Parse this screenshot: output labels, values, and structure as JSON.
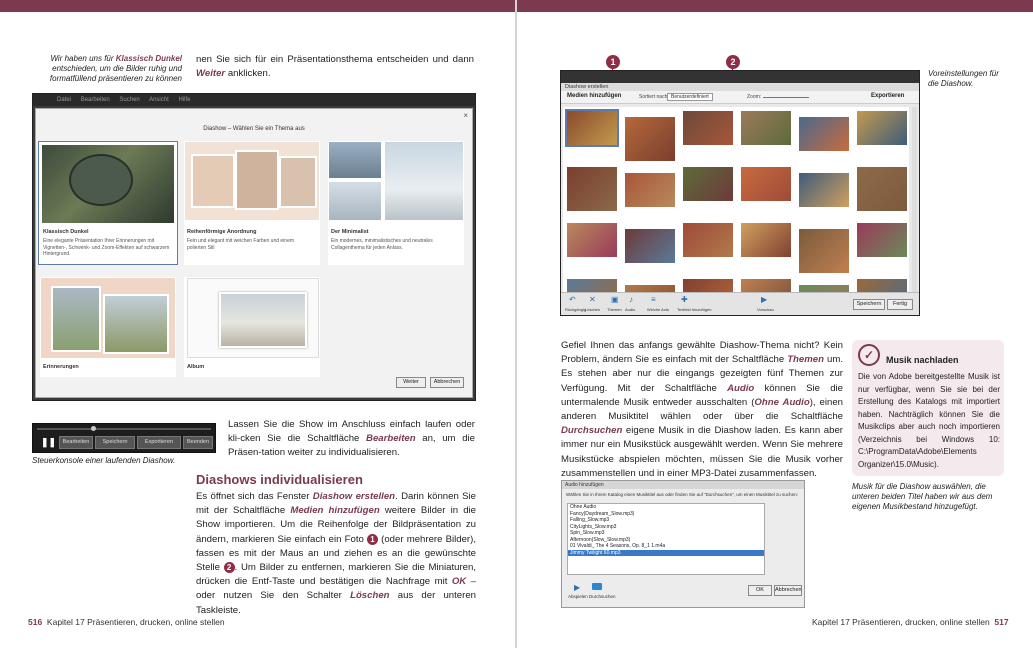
{
  "colors": {
    "accent": "#7b3a4f",
    "marker": "#8d2e46"
  },
  "left_page": {
    "caption_top": "Wir haben uns für Klassisch Dunkel entschieden, um die Bilder ruhig und formatfüllend präsentieren zu können",
    "caption_top_highlight": "Klassisch Dunkel",
    "caption_top_pre": "Wir haben uns für ",
    "caption_top_post": " entschieden, um die Bilder ruhig und formatfüllend präsentieren zu können",
    "intro_pre": "nen Sie sich für ein Präsentationsthema entscheiden und dann ",
    "intro_highlight": "Weiter",
    "intro_post": " anklicken.",
    "app_menu": [
      "Datei",
      "Bearbeiten",
      "Suchen",
      "Ansicht",
      "Hilfe"
    ],
    "dialog_title": "Diashow – Wählen Sie ein Thema aus",
    "themes": [
      {
        "title": "Klassisch Dunkel",
        "text": "Eine elegante Präsentation Ihrer Erinnerungen mit Vignetten-, Schwenk- und Zoom-Effekten auf schwarzem Hintergrund."
      },
      {
        "title": "Reihenförmige Anordnung",
        "text": "Fein und elegant mit weichen Farben und einem polierten Stil"
      },
      {
        "title": "Der Minimalist",
        "text": "Ein modernes, minimalistisches und neutrales Collagenthema für jeden Anlass."
      },
      {
        "title": "Erinnerungen",
        "text": ""
      },
      {
        "title": "Album",
        "text": ""
      }
    ],
    "dialog_buttons": {
      "next": "Weiter",
      "cancel": "Abbrechen"
    },
    "console_buttons": [
      "Bearbeiten",
      "Speichern",
      "Exportieren",
      "Beenden"
    ],
    "console_caption": "Steuerkonsole einer laufenden Diashow.",
    "show_pre": "Lassen Sie die Show im Anschluss einfach laufen oder kli-cken Sie die Schaltfläche ",
    "show_highlight": "Bearbeiten",
    "show_post": " an, um die Präsen-tation weiter zu individualisieren.",
    "heading": "Diashows individualisieren",
    "paragraph_parts": [
      {
        "t": "Es öffnet sich das Fenster ",
        "h": false
      },
      {
        "t": "Diashow erstellen",
        "h": true
      },
      {
        "t": ". Darin können Sie mit der Schaltfläche ",
        "h": false
      },
      {
        "t": "Medien hinzufügen",
        "h": true
      },
      {
        "t": " weitere Bilder in die Show importieren. Um die Reihenfolge der Bildpräsentation zu ändern, markieren Sie einfach ein Foto ",
        "h": false
      },
      {
        "t": "1",
        "n": true
      },
      {
        "t": " (oder mehrere Bilder), fassen es mit der Maus an und ziehen es an die gewünschte Stelle ",
        "h": false
      },
      {
        "t": "2",
        "n": true
      },
      {
        "t": ". Um Bilder zu entfernen, markieren Sie die Miniaturen, drücken die Entf-Taste und bestätigen die Nachfrage mit ",
        "h": false
      },
      {
        "t": "OK",
        "h": true
      },
      {
        "t": " – oder nutzen Sie den Schalter ",
        "h": false
      },
      {
        "t": "Löschen",
        "h": true
      },
      {
        "t": " aus der unteren Taskleiste.",
        "h": false
      }
    ],
    "footer_page": "516",
    "footer_chapter": "Kapitel 17   Präsentieren, drucken, online stellen"
  },
  "right_page": {
    "caption_settings": "Voreinstellungen für die Diashow.",
    "marker_1": "1",
    "marker_2": "2",
    "editor_title": "Diashow erstellen",
    "editor_add_media": "Medien hinzufügen",
    "editor_sort": "Sortiert nach:",
    "editor_sort_value": "Benutzerdefiniert",
    "editor_zoom": "Zoom:",
    "editor_export": "Exportieren",
    "editor_tools": [
      "Rückgängig",
      "Löschen",
      "Themen",
      "Audio",
      "Welche Acts",
      "Textfeld hinzufügen",
      "Vorschau"
    ],
    "editor_save": "Speichern",
    "editor_done": "Fertig",
    "text_parts": [
      {
        "t": "Gefiel Ihnen das anfangs gewählte Diashow-Thema nicht? Kein Problem, ändern Sie es einfach mit der Schaltfläche ",
        "h": false
      },
      {
        "t": "Themen",
        "h": true
      },
      {
        "t": " um. Es stehen aber nur die eingangs gezeigten fünf Themen zur Verfügung. Mit der Schaltfläche ",
        "h": false
      },
      {
        "t": "Audio",
        "h": true
      },
      {
        "t": " können Sie die untermalende Musik entweder ausschalten (",
        "h": false
      },
      {
        "t": "Ohne Audio",
        "h": true
      },
      {
        "t": "), einen anderen Musiktitel wählen oder über die Schaltfläche ",
        "h": false
      },
      {
        "t": "Durchsuchen",
        "h": true
      },
      {
        "t": " eigene Musik in die Diashow laden. Es kann aber immer nur ein Musikstück ausgewählt werden. Wenn Sie mehrere Musikstücke abspielen möchten, müssen Sie die Musik vorher zusammenstellen und in einer MP3-Datei zusammenfassen.",
        "h": false
      }
    ],
    "tip_title": "Musik nachladen",
    "tip_text": "Die von Adobe bereitgestellte Musik ist nur verfügbar, wenn Sie sie bei der Erstellung des Katalogs mit importiert haben. Nachträglich können Sie die Musikclips aber auch noch importieren (Verzeichnis bei Windows 10: C:\\ProgramData\\Adobe\\Elements Organizer\\15.0\\Music).",
    "audio_title": "Audio hinzufügen",
    "audio_hint": "Wählen Sie in Ihrem Katalog einen Musiktitel aus oder finden Sie auf \"Durchsuchen\", um einen Musiktitel zu suchen:",
    "audio_items": [
      "Ohne Audio",
      "Fancy(Daydream_Slow.mp3)",
      "Falling_Slow.mp3",
      "CityLights_Slow.mp3",
      "Spin_Slow.mp3",
      "Afternoon(Slow_Slow.mp3)",
      "01 Vivaldi_ The 4 Seasons, Op. 8_1 1.m4a",
      "Jimmy Twilight 60.mp3"
    ],
    "audio_selected": 7,
    "audio_tools": [
      "Abspielen",
      "Durchsuchen"
    ],
    "audio_ok": "OK",
    "audio_cancel": "Abbrechen",
    "caption_music": "Musik für die Diashow auswählen, die unteren beiden Titel haben wir aus dem eigenen Musikbestand hinzugefügt.",
    "footer_chapter": "Kapitel 17   Präsentieren, drucken, online stellen",
    "footer_page": "517"
  }
}
